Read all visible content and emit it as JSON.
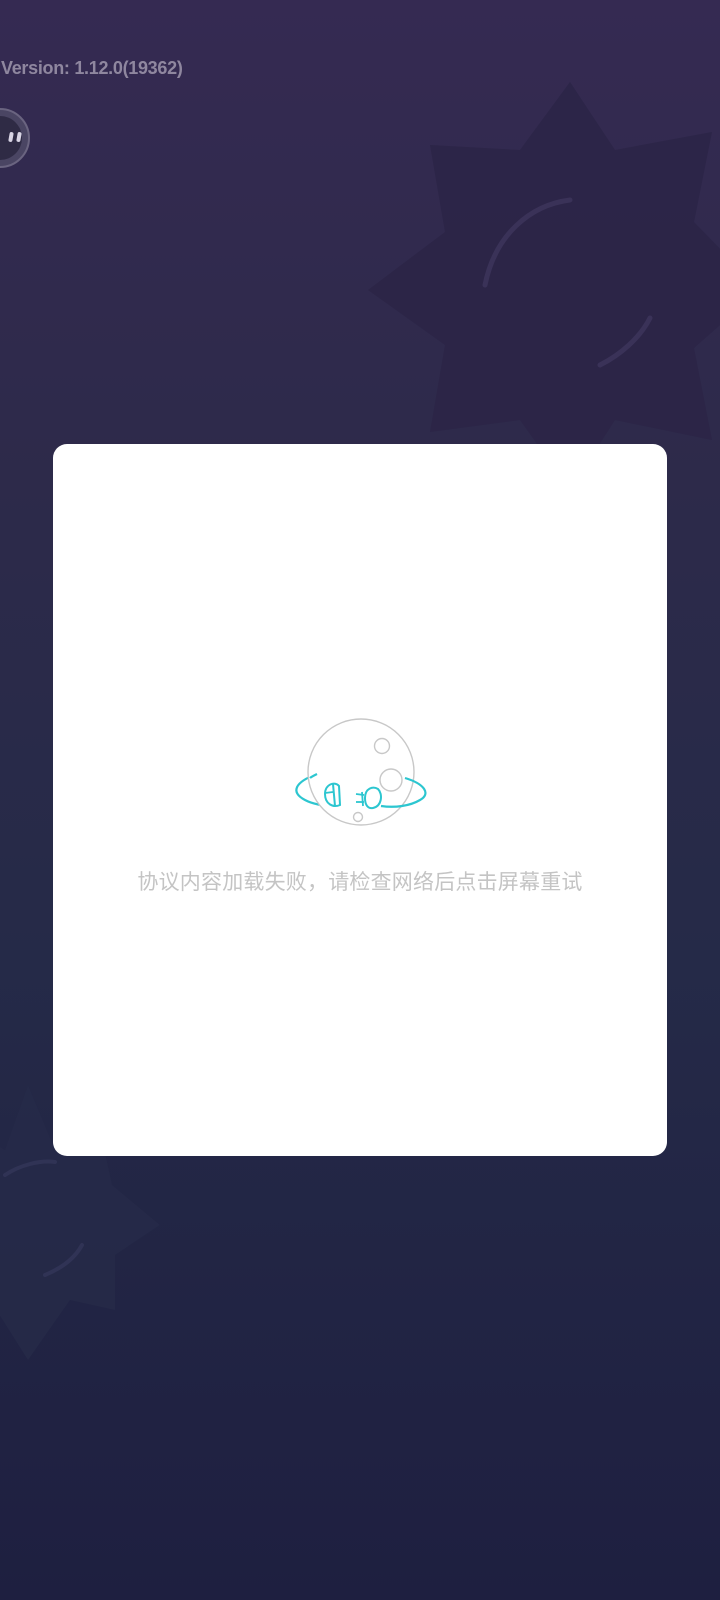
{
  "header": {
    "version_text": "Version: 1.12.0(19362)"
  },
  "avatar": {
    "icon": "robot-avatar-icon"
  },
  "dialog": {
    "illustration_icon": "planet-unplugged-icon",
    "error_message": "协议内容加载失败，请检查网络后点击屏幕重试"
  },
  "colors": {
    "background_top": "#352a52",
    "background_bottom": "#1e1f40",
    "accent": "#2cc6d0",
    "message_text": "#c4c4c4",
    "version_text": "#8f879f"
  }
}
